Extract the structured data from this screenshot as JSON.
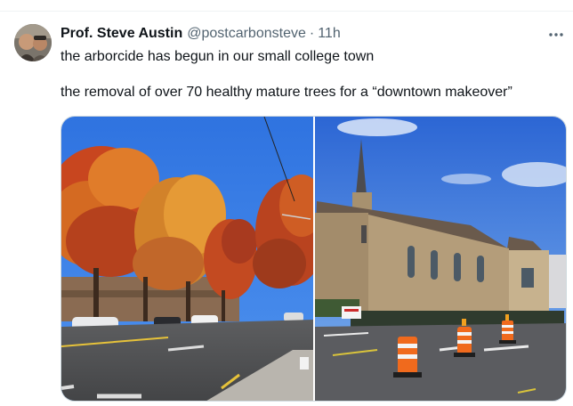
{
  "tweet": {
    "author_name": "Prof. Steve Austin",
    "handle": "@postcarbonsteve",
    "separator": "·",
    "time": "11h",
    "text_line_1": "the arborcide has begun in our small college town",
    "text_line_2": "the removal of over 70 healthy mature trees for a “downtown makeover”"
  },
  "icons": {
    "more": "more-horizontal-icon"
  },
  "colors": {
    "primary_text": "#0f1419",
    "secondary_text": "#536471",
    "divider": "#eff3f4",
    "media_border": "#cfd9de"
  }
}
